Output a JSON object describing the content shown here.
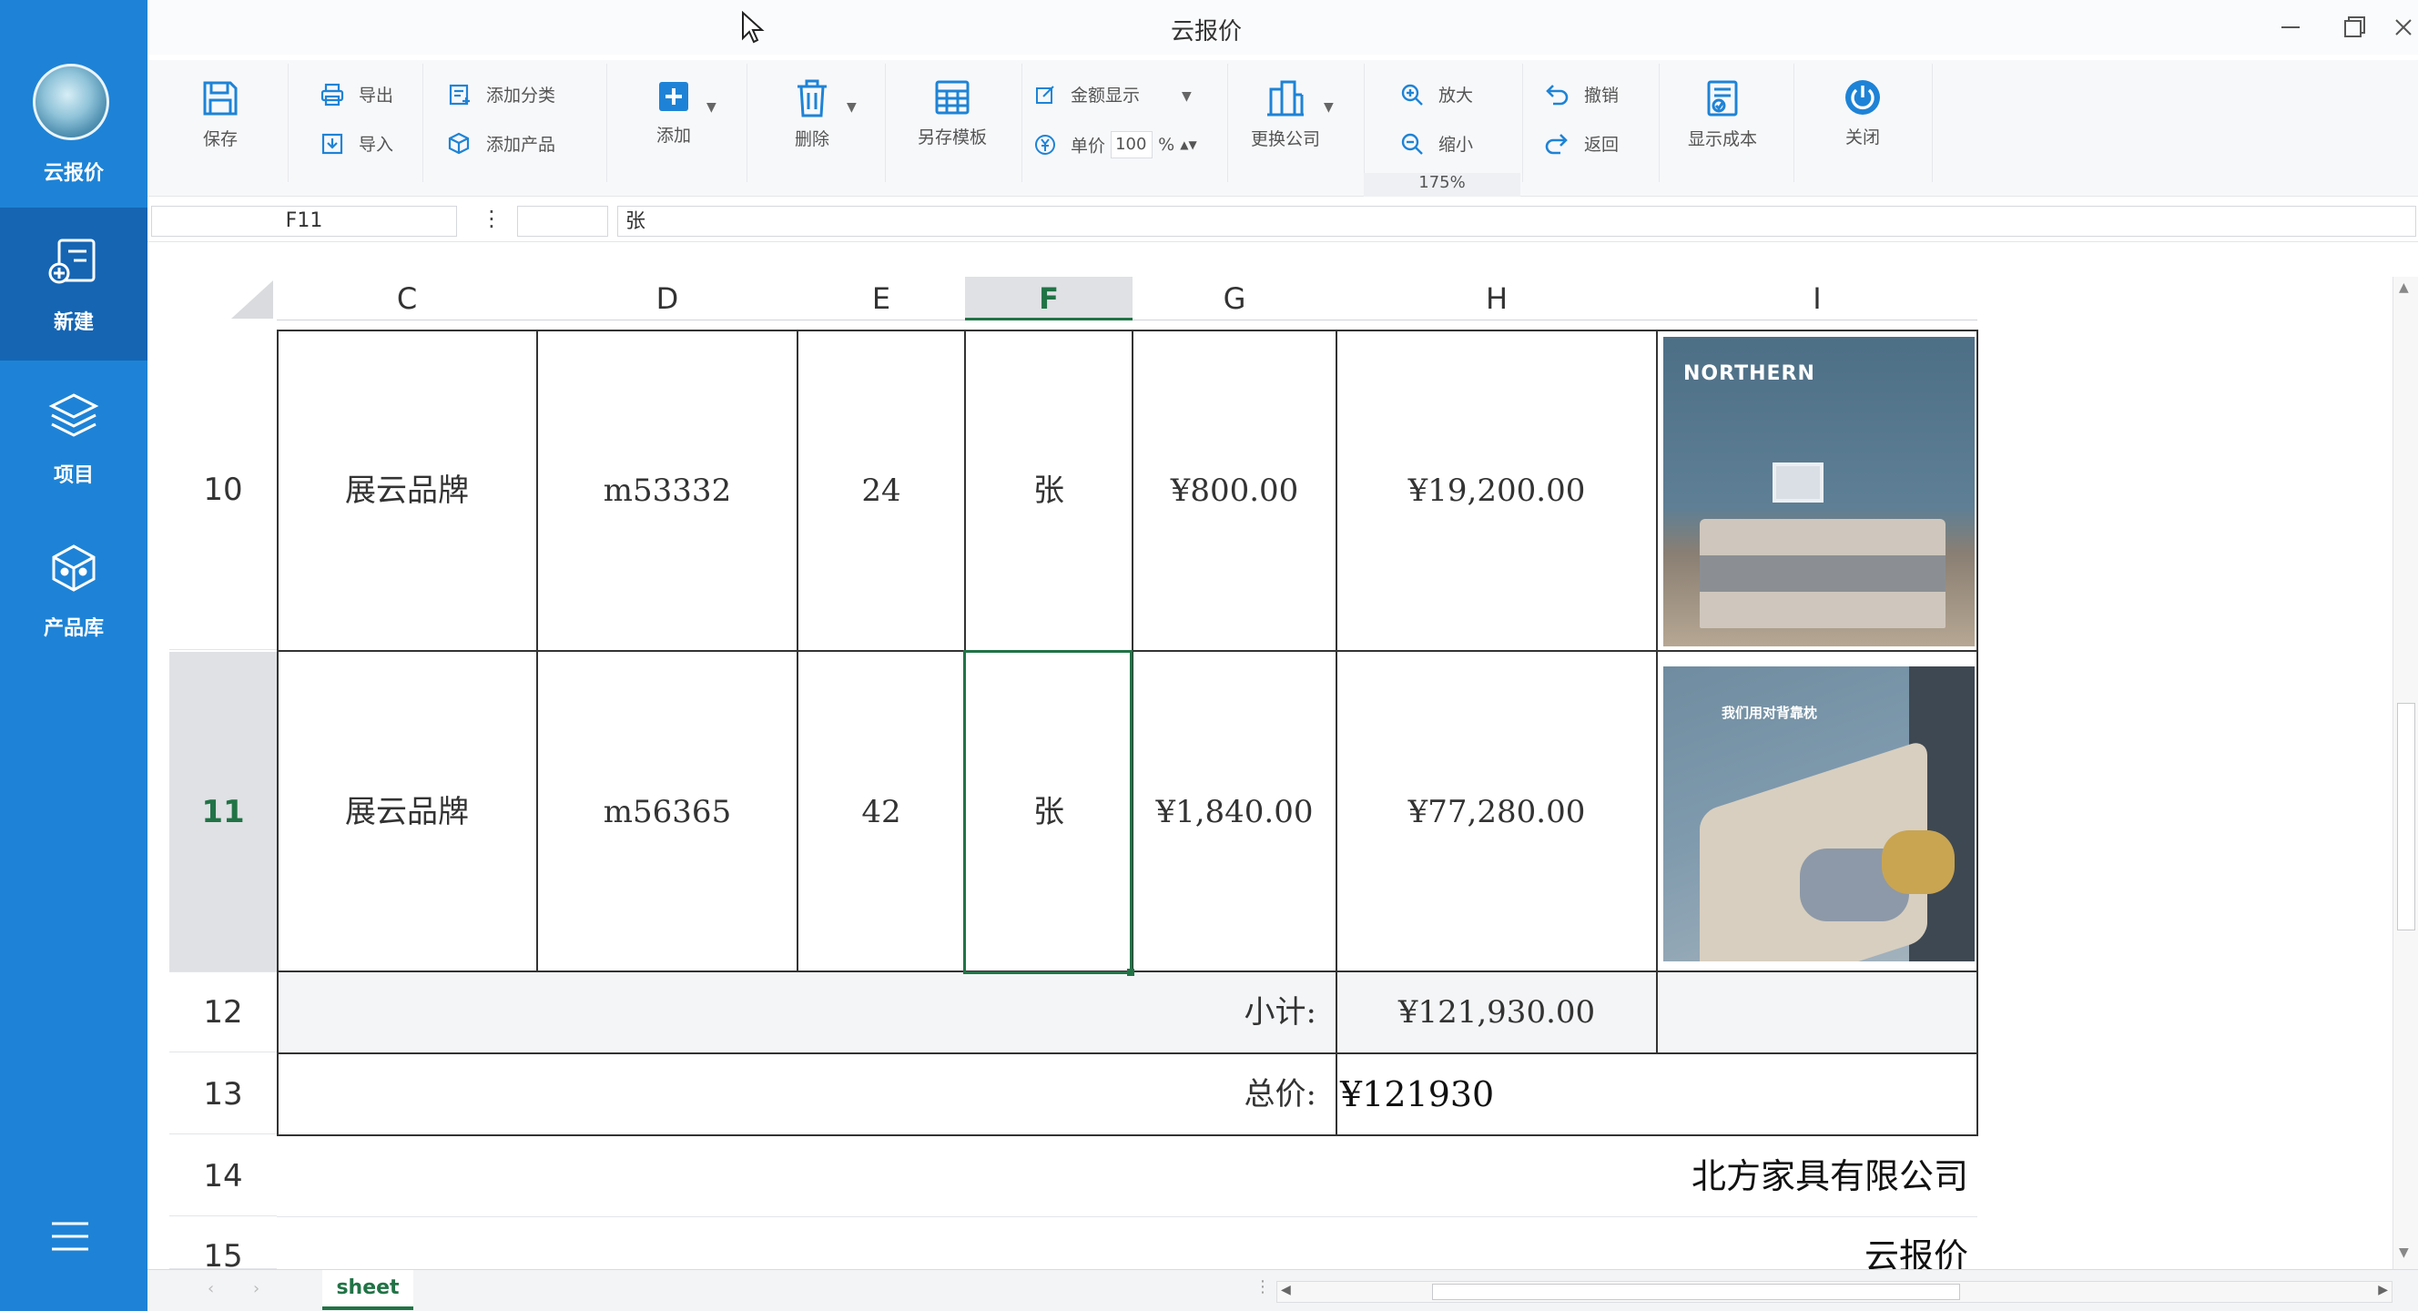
{
  "window": {
    "title": "云报价"
  },
  "sidebar": {
    "brand_label": "云报价",
    "items": [
      {
        "label": "新建",
        "icon": "new-doc-icon"
      },
      {
        "label": "项目",
        "icon": "layers-icon"
      },
      {
        "label": "产品库",
        "icon": "box-icon"
      }
    ],
    "menu_icon": "hamburger-icon"
  },
  "ribbon": {
    "save": "保存",
    "export": "导出",
    "import": "导入",
    "add_category": "添加分类",
    "add_product": "添加产品",
    "add": "添加",
    "delete": "删除",
    "save_template": "另存模板",
    "amount_display": "金额显示",
    "unit_price": "单价",
    "unit_price_value": "100",
    "percent": "%",
    "change_company": "更换公司",
    "zoom_in": "放大",
    "zoom_out": "缩小",
    "zoom_level": "175%",
    "undo": "撤销",
    "back": "返回",
    "show_cost": "显示成本",
    "close": "关闭"
  },
  "formula_bar": {
    "name_box": "F11",
    "separator": "⋮",
    "value": "张"
  },
  "grid": {
    "columns": [
      "C",
      "D",
      "E",
      "F",
      "G",
      "H",
      "I"
    ],
    "selected_column": "F",
    "rows": [
      {
        "row": "10",
        "brand": "展云品牌",
        "model": "m53332",
        "qty": "24",
        "unit": "张",
        "price": "¥800.00",
        "total": "¥19,200.00",
        "image_text": "NORTHERN"
      },
      {
        "row": "11",
        "brand": "展云品牌",
        "model": "m56365",
        "qty": "42",
        "unit": "张",
        "price": "¥1,840.00",
        "total": "¥77,280.00",
        "image_text": "我们用对背靠枕"
      }
    ],
    "subtotal": {
      "row": "12",
      "label": "小计:",
      "value": "¥121,930.00"
    },
    "grand_total": {
      "row": "13",
      "label": "总价:",
      "value": "¥121930"
    },
    "row14": {
      "row": "14",
      "company": "北方家具有限公司"
    },
    "row15": {
      "row": "15",
      "text": "云报价"
    }
  },
  "sheet_tabs": [
    {
      "label": "sheet",
      "active": true
    }
  ],
  "colors": {
    "sidebar": "#1e83d6",
    "sidebar_active": "#1565b3",
    "accent": "#217346"
  }
}
